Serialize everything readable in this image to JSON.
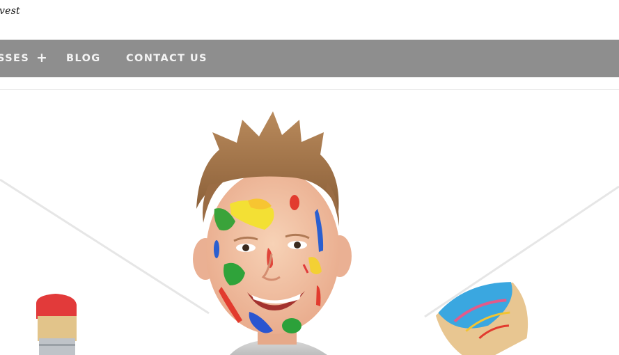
{
  "header": {
    "tagline": "vest"
  },
  "nav": {
    "items": [
      {
        "label": "SSES",
        "has_submenu": true,
        "submenu_indicator": "+"
      },
      {
        "label": "BLOG"
      },
      {
        "label": "CONTACT US"
      }
    ]
  },
  "hero": {
    "image_subject": "child with paint-splattered face holding paintbrushes"
  },
  "colors": {
    "nav_background": "#8e8e8e",
    "nav_text": "#f4f4f4",
    "page_background": "#ffffff"
  }
}
